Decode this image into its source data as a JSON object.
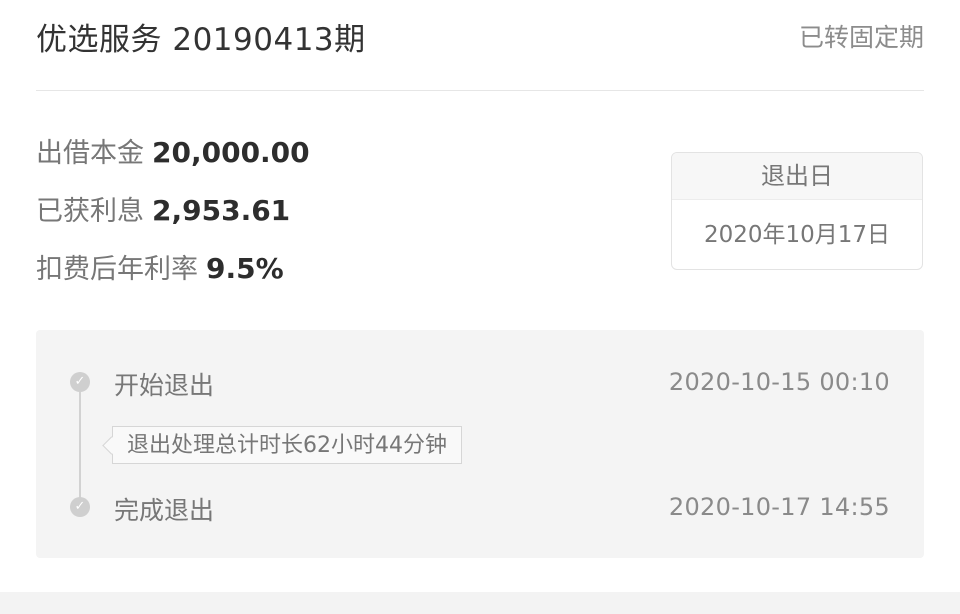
{
  "header": {
    "title": "优选服务 20190413期",
    "status": "已转固定期"
  },
  "summary": {
    "rows": [
      {
        "label": "出借本金",
        "value": "20,000.00"
      },
      {
        "label": "已获利息",
        "value": "2,953.61"
      },
      {
        "label": "扣费后年利率",
        "value": "9.5%"
      }
    ]
  },
  "exit_box": {
    "label": "退出日",
    "date": "2020年10月17日"
  },
  "timeline": {
    "steps": [
      {
        "label": "开始退出",
        "time": "2020-10-15 00:10",
        "icon": "check-circle-icon"
      },
      {
        "label": "完成退出",
        "time": "2020-10-17 14:55",
        "icon": "check-circle-icon"
      }
    ],
    "note": "退出处理总计时长62小时44分钟"
  }
}
